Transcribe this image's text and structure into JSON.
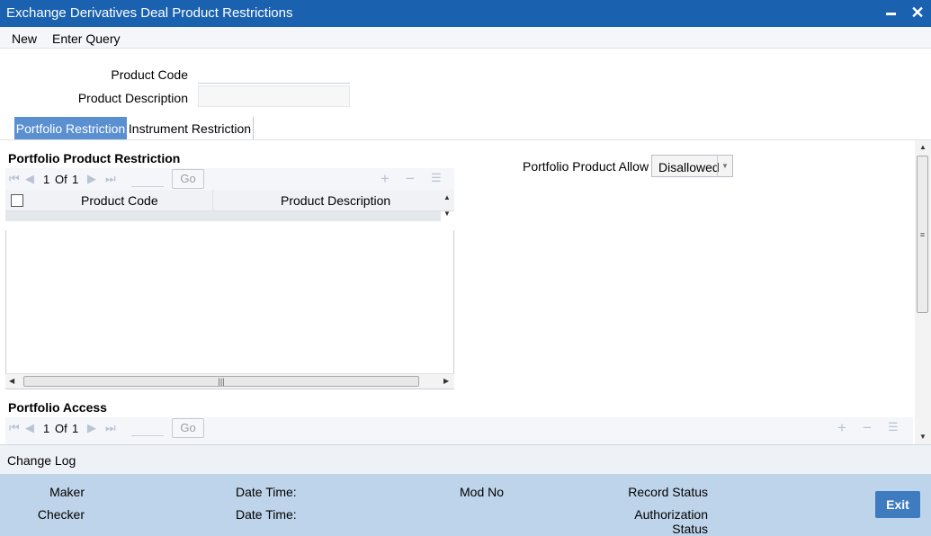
{
  "window": {
    "title": "Exchange Derivatives Deal Product Restrictions"
  },
  "menu": {
    "new": "New",
    "enter_query": "Enter Query"
  },
  "header": {
    "product_code_label": "Product Code",
    "product_description_label": "Product Description",
    "product_code_value": "",
    "product_description_value": ""
  },
  "tabs": [
    {
      "label": "Portfolio Restriction",
      "active": true
    },
    {
      "label": "Instrument Restriction",
      "active": false
    }
  ],
  "portfolio_product_restriction": {
    "title": "Portfolio Product Restriction",
    "page_current": "1",
    "page_of": "Of",
    "page_total": "1",
    "go_label": "Go",
    "columns": [
      "Product Code",
      "Product Description"
    ]
  },
  "portfolio_product_allow": {
    "label": "Portfolio Product Allow",
    "value": "Disallowed"
  },
  "portfolio_access": {
    "title": "Portfolio Access",
    "page_current": "1",
    "page_of": "Of",
    "page_total": "1",
    "go_label": "Go"
  },
  "change_log": {
    "label": "Change Log"
  },
  "footer": {
    "maker": "Maker",
    "checker": "Checker",
    "date_time_1": "Date Time:",
    "date_time_2": "Date Time:",
    "mod_no": "Mod No",
    "record_status": "Record Status",
    "authorization_status_line1": "Authorization",
    "authorization_status_line2": "Status",
    "exit": "Exit"
  },
  "colors": {
    "titlebar": "#1a62b0",
    "active_tab": "#5a8fd0",
    "footer": "#bed4ea",
    "exit_button": "#3f7cbf"
  }
}
